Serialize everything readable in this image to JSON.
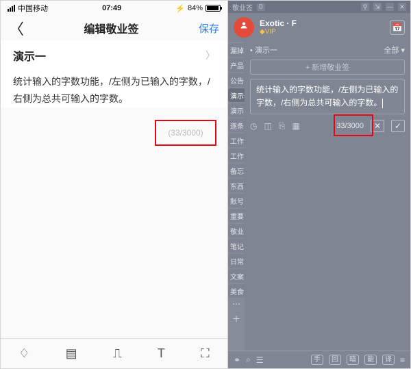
{
  "phone": {
    "status": {
      "carrier": "中国移动",
      "time": "07:49",
      "battery_pct": "84%"
    },
    "nav": {
      "title": "编辑敬业签",
      "save": "保存"
    },
    "note_title": "演示一",
    "note_body": "统计输入的字数功能，/左侧为已输入的字数，/右侧为总共可输入的字数。",
    "counter": "(33/3000)",
    "toolbar_icons": [
      "bell",
      "image",
      "mic",
      "text",
      "scan"
    ]
  },
  "desk": {
    "app_title": "敬业签",
    "title_badge": "0",
    "user": {
      "name": "Exotic · F",
      "vip": "◆VIP"
    },
    "crumb_label": "演示一",
    "crumb_filter": "全部",
    "add_label": "+ 新增敬业签",
    "note_body": "统计输入的字数功能，/左侧为已输入的字数，/右侧为总共可输入的字数。",
    "counter": "33/3000",
    "sidebar": [
      "漏掉",
      "产品",
      "公告",
      "演示一",
      "演示",
      "逐条",
      "工作",
      "工作",
      "备忘",
      "东西",
      "账号",
      "重要",
      "敬业",
      "笔记",
      "日常",
      "文案",
      "美食"
    ],
    "footer_pills": [
      "手",
      "回",
      "暗",
      "能",
      "译"
    ]
  }
}
